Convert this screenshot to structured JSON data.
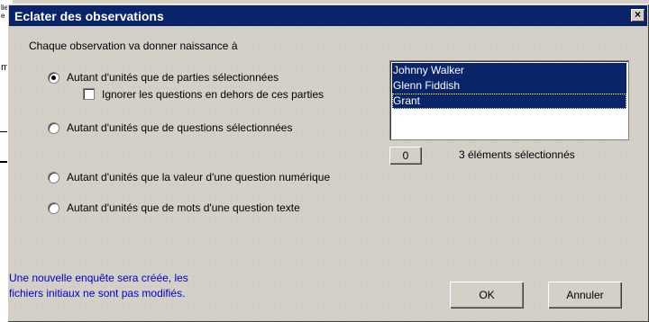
{
  "background_app": {
    "fragments": [
      "lie",
      "e i",
      "m"
    ]
  },
  "dialog": {
    "title": "Eclater des observations",
    "close_icon": "×",
    "intro": "Chaque observation va donner naissance à",
    "options": [
      {
        "label": "Autant d'unités que de parties sélectionnées",
        "selected": true
      },
      {
        "label": "Autant d'unités que de questions sélectionnées",
        "selected": false
      },
      {
        "label": "Autant d'unités que la valeur d'une question numérique",
        "selected": false
      },
      {
        "label": "Autant d'unités que de mots d'une question texte",
        "selected": false
      }
    ],
    "ignore_checkbox": {
      "label": "Ignorer les questions en dehors de ces parties",
      "checked": false
    },
    "list": {
      "items": [
        "Johnny Walker",
        "Glenn Fiddish",
        "Grant"
      ],
      "selected_count_label": "3 éléments sélectionnés",
      "clear_button": "0"
    },
    "info": {
      "line1": "Une nouvelle enquête sera créée, les",
      "line2": "fichiers initiaux ne sont pas modifiés."
    },
    "ok_button": "OK",
    "cancel_button": "Annuler",
    "colors": {
      "titlebar": "#0a246a",
      "selection": "#0a246a",
      "info_text": "#0000cc"
    }
  }
}
